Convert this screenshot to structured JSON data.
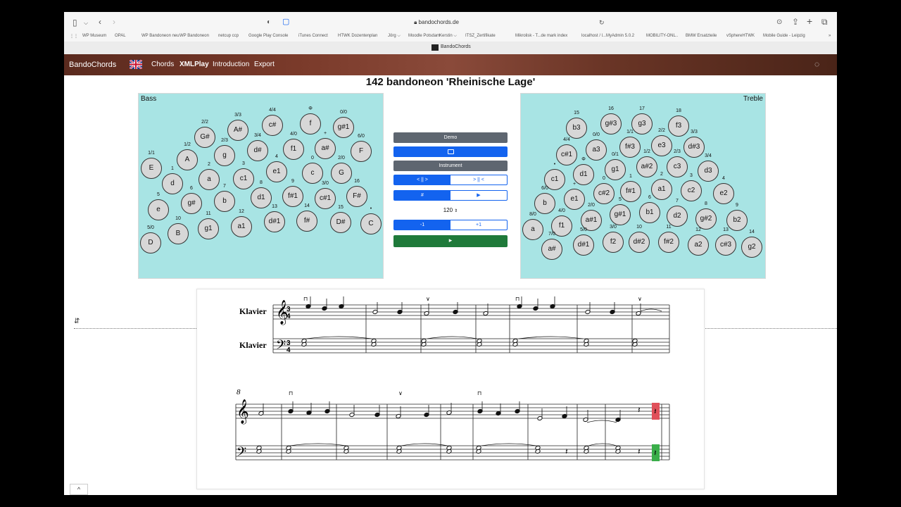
{
  "browser": {
    "url": "bandochords.de",
    "bookmarks": [
      "WP Museum",
      "OPAL",
      "WP Bandoneon neu",
      "WP Bandoneon",
      "netcup ccp",
      "Google Play Console",
      "iTunes Connect",
      "HTWK Dozentenplan",
      "Jörg ⌵",
      "Moodle Potsdam",
      "Kerstin ⌵",
      "ITSZ_Zertifikate",
      "Mikrolisk - T...de mark index",
      "localhost / l...MyAdmin 5.0.2",
      "MOBILITY-ONL..",
      "BMW Ersatzteile",
      "vSphereHTWK",
      "Mobile Guide - Leipzig"
    ],
    "tab_title": "BandoChords"
  },
  "nav": {
    "brand": "BandoChords",
    "items": [
      "Chords",
      "XMLPlay",
      "Introduction",
      "Export"
    ],
    "active": "XMLPlay"
  },
  "page": {
    "title": "142 bandoneon 'Rheinische Lage'"
  },
  "bass": {
    "title": "Bass",
    "keys": [
      {
        "n": "E",
        "l": "1/1"
      },
      {
        "n": "A",
        "l": "1/2"
      },
      {
        "n": "G#",
        "l": "2/2"
      },
      {
        "n": "g",
        "l": "2/3"
      },
      {
        "n": "A#",
        "l": "3/3"
      },
      {
        "n": "d#",
        "l": "3/4"
      },
      {
        "n": "c#",
        "l": "4/4"
      },
      {
        "n": "f1",
        "l": "4/0"
      },
      {
        "n": "f",
        "l": "Φ"
      },
      {
        "n": "a#",
        "l": "+"
      },
      {
        "n": "g#1",
        "l": "0/0"
      },
      {
        "n": "F",
        "l": "6/0"
      },
      {
        "n": "d",
        "l": "1"
      },
      {
        "n": "a",
        "l": "2"
      },
      {
        "n": "c1",
        "l": "3"
      },
      {
        "n": "e1",
        "l": "4"
      },
      {
        "n": "c",
        "l": "0"
      },
      {
        "n": "G",
        "l": "2/0"
      },
      {
        "n": "e",
        "l": "5"
      },
      {
        "n": "g#",
        "l": "6"
      },
      {
        "n": "b",
        "l": "7"
      },
      {
        "n": "d1",
        "l": "8"
      },
      {
        "n": "f#1",
        "l": "9"
      },
      {
        "n": "c#1",
        "l": "3/0"
      },
      {
        "n": "F#",
        "l": "16"
      },
      {
        "n": "D",
        "l": "5/0"
      },
      {
        "n": "B",
        "l": "10"
      },
      {
        "n": "g1",
        "l": "11"
      },
      {
        "n": "a1",
        "l": "12"
      },
      {
        "n": "d#1",
        "l": "13"
      },
      {
        "n": "f#",
        "l": "14"
      },
      {
        "n": "D#",
        "l": "15"
      },
      {
        "n": "C",
        "l": "•"
      }
    ]
  },
  "treble": {
    "title": "Treble",
    "keys": [
      {
        "n": "b3",
        "l": "15"
      },
      {
        "n": "g#3",
        "l": "16"
      },
      {
        "n": "g3",
        "l": "17"
      },
      {
        "n": "f3",
        "l": "18"
      },
      {
        "n": "c#1",
        "l": "4/4"
      },
      {
        "n": "a3",
        "l": "0/0"
      },
      {
        "n": "f#3",
        "l": "1/1"
      },
      {
        "n": "e3",
        "l": "2/2"
      },
      {
        "n": "d#3",
        "l": "3/3"
      },
      {
        "n": "c1",
        "l": "•"
      },
      {
        "n": "d1",
        "l": "Φ"
      },
      {
        "n": "g1",
        "l": "0/1"
      },
      {
        "n": "a#2",
        "l": "1/2"
      },
      {
        "n": "c3",
        "l": "2/3"
      },
      {
        "n": "d3",
        "l": "3/4"
      },
      {
        "n": "b",
        "l": "6/0"
      },
      {
        "n": "e1",
        "l": "+"
      },
      {
        "n": "c#2",
        "l": "0"
      },
      {
        "n": "f#1",
        "l": "1"
      },
      {
        "n": "a1",
        "l": "2"
      },
      {
        "n": "c2",
        "l": "3"
      },
      {
        "n": "e2",
        "l": "4"
      },
      {
        "n": "a",
        "l": "8/0"
      },
      {
        "n": "f1",
        "l": "4/0"
      },
      {
        "n": "a#1",
        "l": "2/0"
      },
      {
        "n": "g#1",
        "l": "5"
      },
      {
        "n": "b1",
        "l": "6"
      },
      {
        "n": "d2",
        "l": "7"
      },
      {
        "n": "g#2",
        "l": "8"
      },
      {
        "n": "b2",
        "l": "9"
      },
      {
        "n": "a#",
        "l": "7/0"
      },
      {
        "n": "d#1",
        "l": "5/0"
      },
      {
        "n": "f2",
        "l": "3/0"
      },
      {
        "n": "d#2",
        "l": "10"
      },
      {
        "n": "f#2",
        "l": "11"
      },
      {
        "n": "a2",
        "l": "12"
      },
      {
        "n": "c#3",
        "l": "13"
      },
      {
        "n": "g2",
        "l": "14"
      }
    ]
  },
  "controls": {
    "demo": "Demo",
    "instrument": "Instrument",
    "dir_left": "< || >",
    "dir_right": "> || <",
    "sharp": "#",
    "play": "▶",
    "tempo": "120",
    "minus": "-1",
    "plus": "+1"
  },
  "score": {
    "instrument_top": "Klavier",
    "instrument_bottom": "Klavier",
    "time_sig_num": "3",
    "time_sig_den": "4",
    "measure_number": "8",
    "highlight_treble": "#e0505a",
    "highlight_bass": "#3aae4a"
  }
}
